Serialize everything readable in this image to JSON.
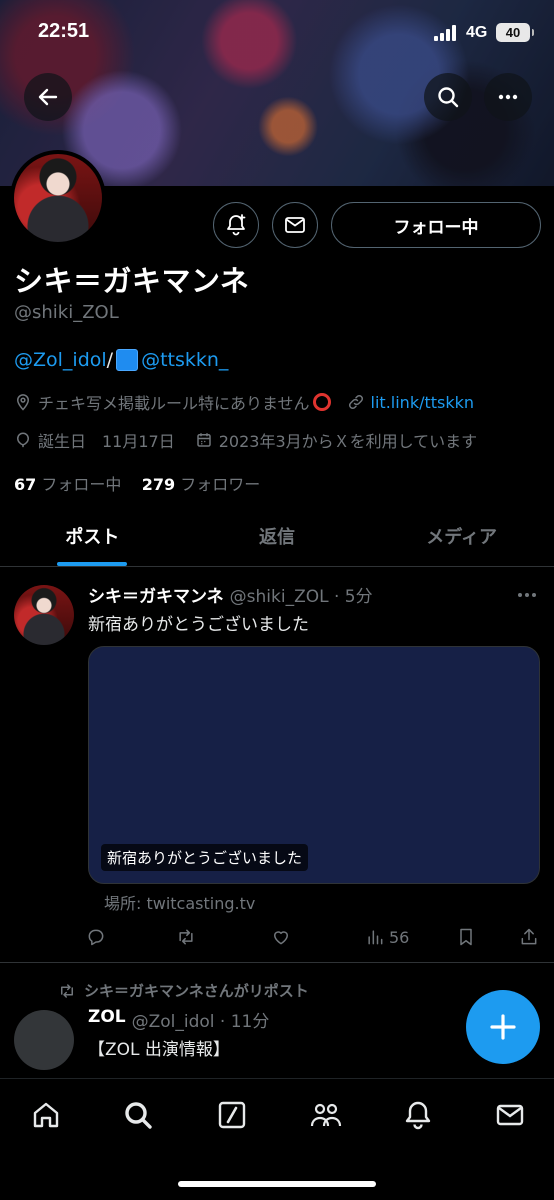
{
  "status_bar": {
    "time": "22:51",
    "network": "4G",
    "battery": "40"
  },
  "header": {
    "back_icon": "arrow-left-icon",
    "search_icon": "search-icon",
    "more_icon": "more-horizontal-icon"
  },
  "profile": {
    "follow_button_label": "フォロー中",
    "display_name": "シキ＝ガキマンネ",
    "handle": "@shiki_ZOL",
    "bio": {
      "mention1": "@Zol_idol",
      "separator": "/",
      "mention2": "@ttskkn_"
    },
    "location": "チェキ写メ掲載ルール特にありません",
    "website": "lit.link/ttskkn",
    "birthday": "誕生日　11月17日",
    "joined": "2023年3月からＸを利用しています",
    "following_count": "67",
    "following_label": "フォロー中",
    "followers_count": "279",
    "followers_label": "フォロワー"
  },
  "tabs": [
    {
      "label": "ポスト",
      "active": true
    },
    {
      "label": "返信",
      "active": false
    },
    {
      "label": "メディア",
      "active": false
    }
  ],
  "tweet": {
    "name": "シキ＝ガキマンネ",
    "meta": "@shiki_ZOL · 5分",
    "text": "新宿ありがとうございました",
    "card_title": "新宿ありがとうございました",
    "card_source": "場所: twitcasting.tv",
    "views": "56"
  },
  "repost": {
    "label": "シキ＝ガキマンネさんがリポスト",
    "name": "ZOL",
    "meta": "@Zol_idol · 11分",
    "text": "【ZOL 出演情報】"
  },
  "colors": {
    "accent": "#1d9bf0",
    "background": "#000000",
    "muted": "#71767b",
    "card_bg": "#162046"
  },
  "bottom_nav": [
    "home-icon",
    "search-icon",
    "grok-icon",
    "communities-icon",
    "bell-icon",
    "mail-icon"
  ]
}
